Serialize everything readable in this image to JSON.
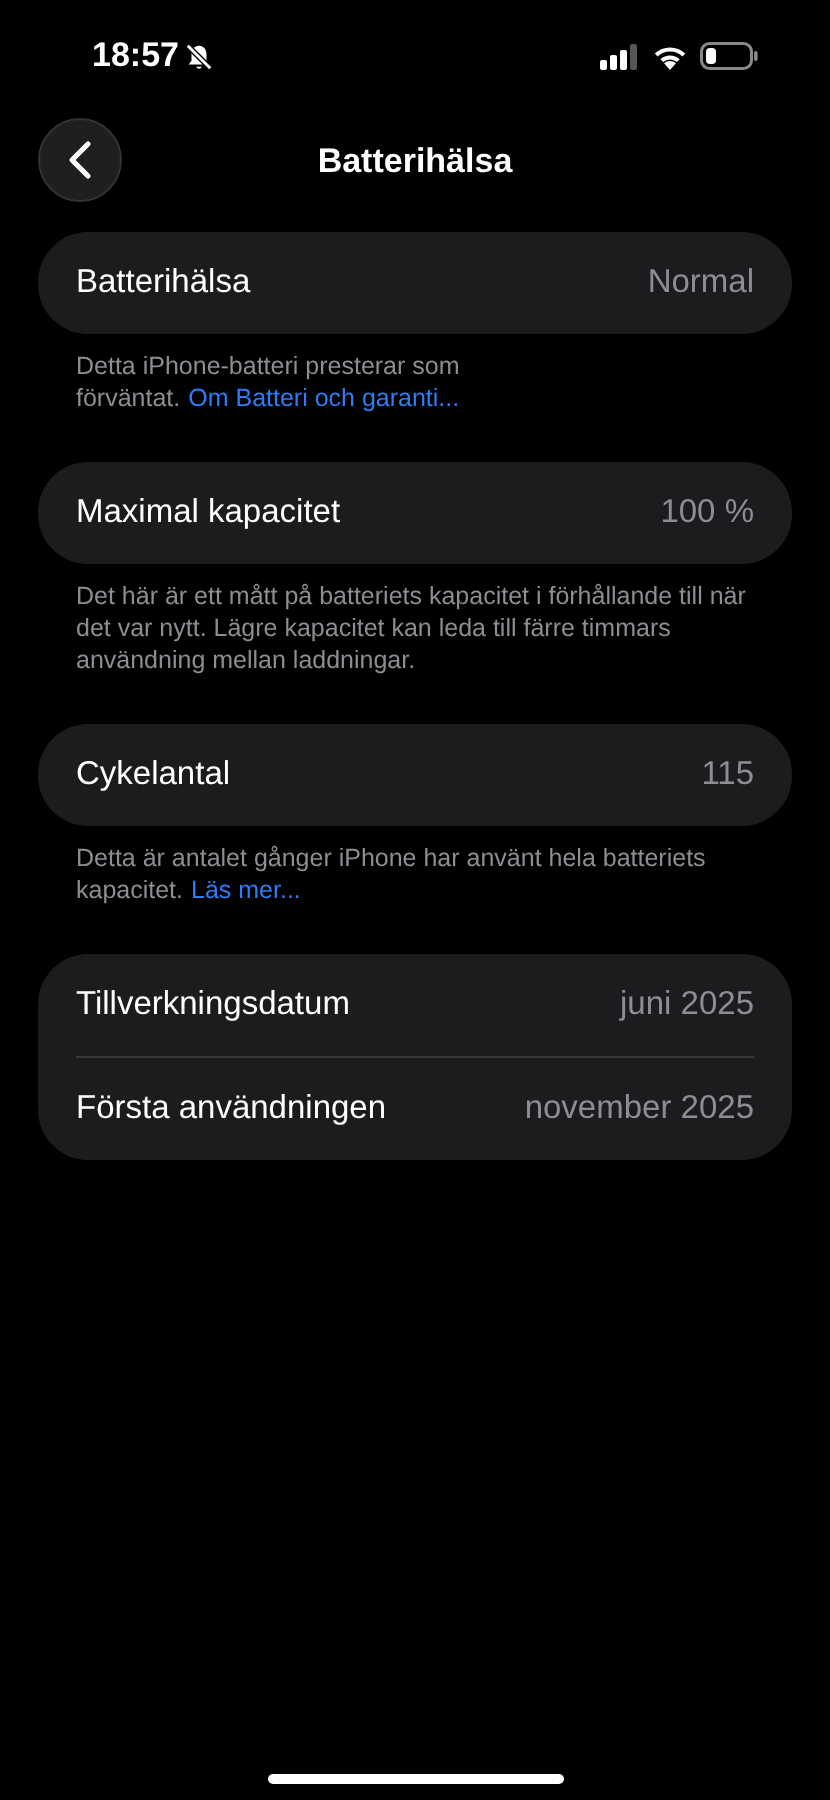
{
  "status_bar": {
    "time": "18:57"
  },
  "nav": {
    "title": "Batterihälsa"
  },
  "sections": [
    {
      "rows": [
        {
          "label": "Batterihälsa",
          "value": "Normal"
        }
      ],
      "footer": {
        "text": "Detta iPhone-batteri presterar som förväntat.",
        "link": "Om Batteri och garanti..."
      }
    },
    {
      "rows": [
        {
          "label": "Maximal kapacitet",
          "value": "100 %"
        }
      ],
      "footer": {
        "text": "Det här är ett mått på batteriets kapacitet i förhållande till när det var nytt. Lägre kapacitet kan leda till färre timmars användning mellan laddningar."
      }
    },
    {
      "rows": [
        {
          "label": "Cykelantal",
          "value": "115"
        }
      ],
      "footer": {
        "text": "Detta är antalet gånger iPhone har använt hela batteriets kapacitet.",
        "link": "Läs mer..."
      }
    },
    {
      "rows": [
        {
          "label": "Tillverkningsdatum",
          "value": "juni 2025"
        },
        {
          "label": "Första användningen",
          "value": "november 2025"
        }
      ]
    }
  ]
}
